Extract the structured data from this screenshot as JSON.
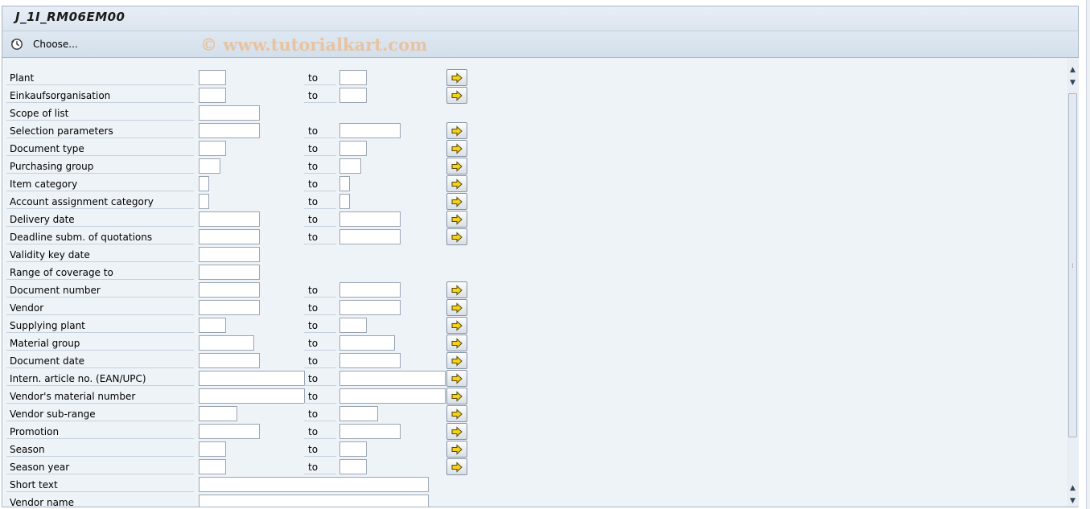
{
  "title": "J_1I_RM06EM00",
  "toolbar": {
    "choose_label": "Choose..."
  },
  "watermark": "© www.tutorialkart.com",
  "to_label": "to",
  "rows": [
    {
      "label": "Plant",
      "from_w": 34,
      "to_w": 34,
      "to": true
    },
    {
      "label": "Einkaufsorganisation",
      "from_w": 34,
      "to_w": 34,
      "to": true
    },
    {
      "label": "Scope of list",
      "from_w": 76,
      "to": false
    },
    {
      "label": "Selection parameters",
      "from_w": 76,
      "to_w": 76,
      "to": true
    },
    {
      "label": "Document type",
      "from_w": 34,
      "to_w": 34,
      "to": true
    },
    {
      "label": "Purchasing group",
      "from_w": 27,
      "to_w": 27,
      "to": true
    },
    {
      "label": "Item category",
      "from_w": 13,
      "to_w": 13,
      "to": true
    },
    {
      "label": "Account assignment category",
      "from_w": 13,
      "to_w": 13,
      "to": true
    },
    {
      "label": "Delivery date",
      "from_w": 76,
      "to_w": 76,
      "to": true
    },
    {
      "label": "Deadline subm. of quotations",
      "from_w": 76,
      "to_w": 76,
      "to": true
    },
    {
      "label": "Validity key date",
      "from_w": 76,
      "to": false
    },
    {
      "label": "Range of coverage to",
      "from_w": 76,
      "to": false
    },
    {
      "label": "Document number",
      "from_w": 76,
      "to_w": 76,
      "to": true
    },
    {
      "label": "Vendor",
      "from_w": 76,
      "to_w": 76,
      "to": true
    },
    {
      "label": "Supplying plant",
      "from_w": 34,
      "to_w": 34,
      "to": true
    },
    {
      "label": "Material group",
      "from_w": 69,
      "to_w": 69,
      "to": true
    },
    {
      "label": "Document date",
      "from_w": 76,
      "to_w": 76,
      "to": true
    },
    {
      "label": "Intern. article no. (EAN/UPC)",
      "from_w": 132,
      "to_w": 132,
      "to": true
    },
    {
      "label": "Vendor's material number",
      "from_w": 132,
      "to_w": 132,
      "to": true
    },
    {
      "label": "Vendor sub-range",
      "from_w": 48,
      "to_w": 48,
      "to": true
    },
    {
      "label": "Promotion",
      "from_w": 76,
      "to_w": 76,
      "to": true
    },
    {
      "label": "Season",
      "from_w": 34,
      "to_w": 34,
      "to": true
    },
    {
      "label": "Season year",
      "from_w": 34,
      "to_w": 34,
      "to": true
    },
    {
      "label": "Short text",
      "from_w": 286,
      "to": false
    },
    {
      "label": "Vendor name",
      "from_w": 286,
      "to": false
    }
  ],
  "icons": {
    "choose": "execute-clock-icon",
    "multiple_selection": "multiple-selection-arrow-icon"
  },
  "colors": {
    "arrow": "#f2d21c",
    "frame_border": "#a5b5c7"
  }
}
